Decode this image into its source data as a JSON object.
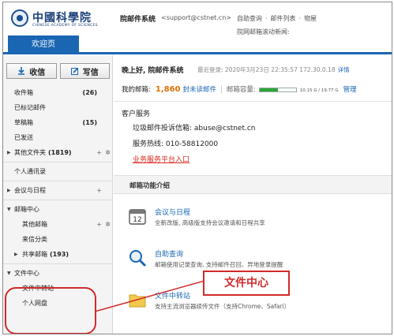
{
  "header": {
    "logo_cn": "中國科學院",
    "logo_en": "CHINESE ACADEMY OF SCIENCES",
    "system_name": "院邮件系统",
    "system_email": "<support@cstnet.cn>",
    "links": [
      "自助查询",
      "·",
      "邮件列表",
      "·",
      "物屋"
    ],
    "scroll_news": "院网邮箱滚动新闻:"
  },
  "tabs": {
    "welcome": "欢迎页"
  },
  "sidebar": {
    "receive_label": "收信",
    "compose_label": "写信",
    "items": [
      {
        "label": "收件箱",
        "count": "(26)"
      },
      {
        "label": "已标记邮件"
      },
      {
        "label": "草稿箱",
        "count": "(15)"
      },
      {
        "label": "已发送"
      },
      {
        "label": "其他文件夹",
        "count": "(1819)"
      },
      {
        "label": "个人通讯录"
      },
      {
        "label": "会议与日程"
      },
      {
        "label": "邮箱中心"
      },
      {
        "label": "其他邮箱"
      },
      {
        "label": "来信分类"
      },
      {
        "label": "共享邮箱",
        "count": "(193)"
      },
      {
        "label": "文件中心"
      },
      {
        "label": "文件中转站"
      },
      {
        "label": "个人网盘"
      }
    ]
  },
  "main": {
    "greeting": "晚上好, 院邮件系统",
    "last_login": "最近登录: 2020年3月23日 22:35:57 172.30.0.18",
    "detail_link": "详情",
    "my_mailbox_label": "我的邮箱:",
    "unread_count": "1,860",
    "unread_label": "封未读邮件",
    "capacity_label": "邮箱容量:",
    "capacity_value": "10.15 G / 19.77 G",
    "capacity_fraction": 0.51,
    "manage_link": "管理",
    "service_title": "客户服务",
    "complaint_line": "垃圾邮件投诉信箱: abuse@cstnet.cn",
    "hotline_line": "服务热线: 010-58812000",
    "service_portal_link": "业务服务平台入口",
    "features_title": "邮箱功能介绍",
    "features": [
      {
        "title": "会议与日程",
        "desc": "全新改版, 高级版支持会议邀请和日程共享"
      },
      {
        "title": "自助查询",
        "desc": "邮箱使用记录查询, 支持邮件召回、异地登录提醒"
      },
      {
        "title": "文件中转站",
        "desc": "支持主流浏览器续传文件（支持Chrome、Safari）"
      }
    ]
  },
  "annotation": {
    "callout_text": "文件中心"
  },
  "colors": {
    "accent_blue": "#1a66b3",
    "unread_orange": "#e07000",
    "link_red": "#d8281c",
    "annotation_red": "#d02a2a"
  }
}
